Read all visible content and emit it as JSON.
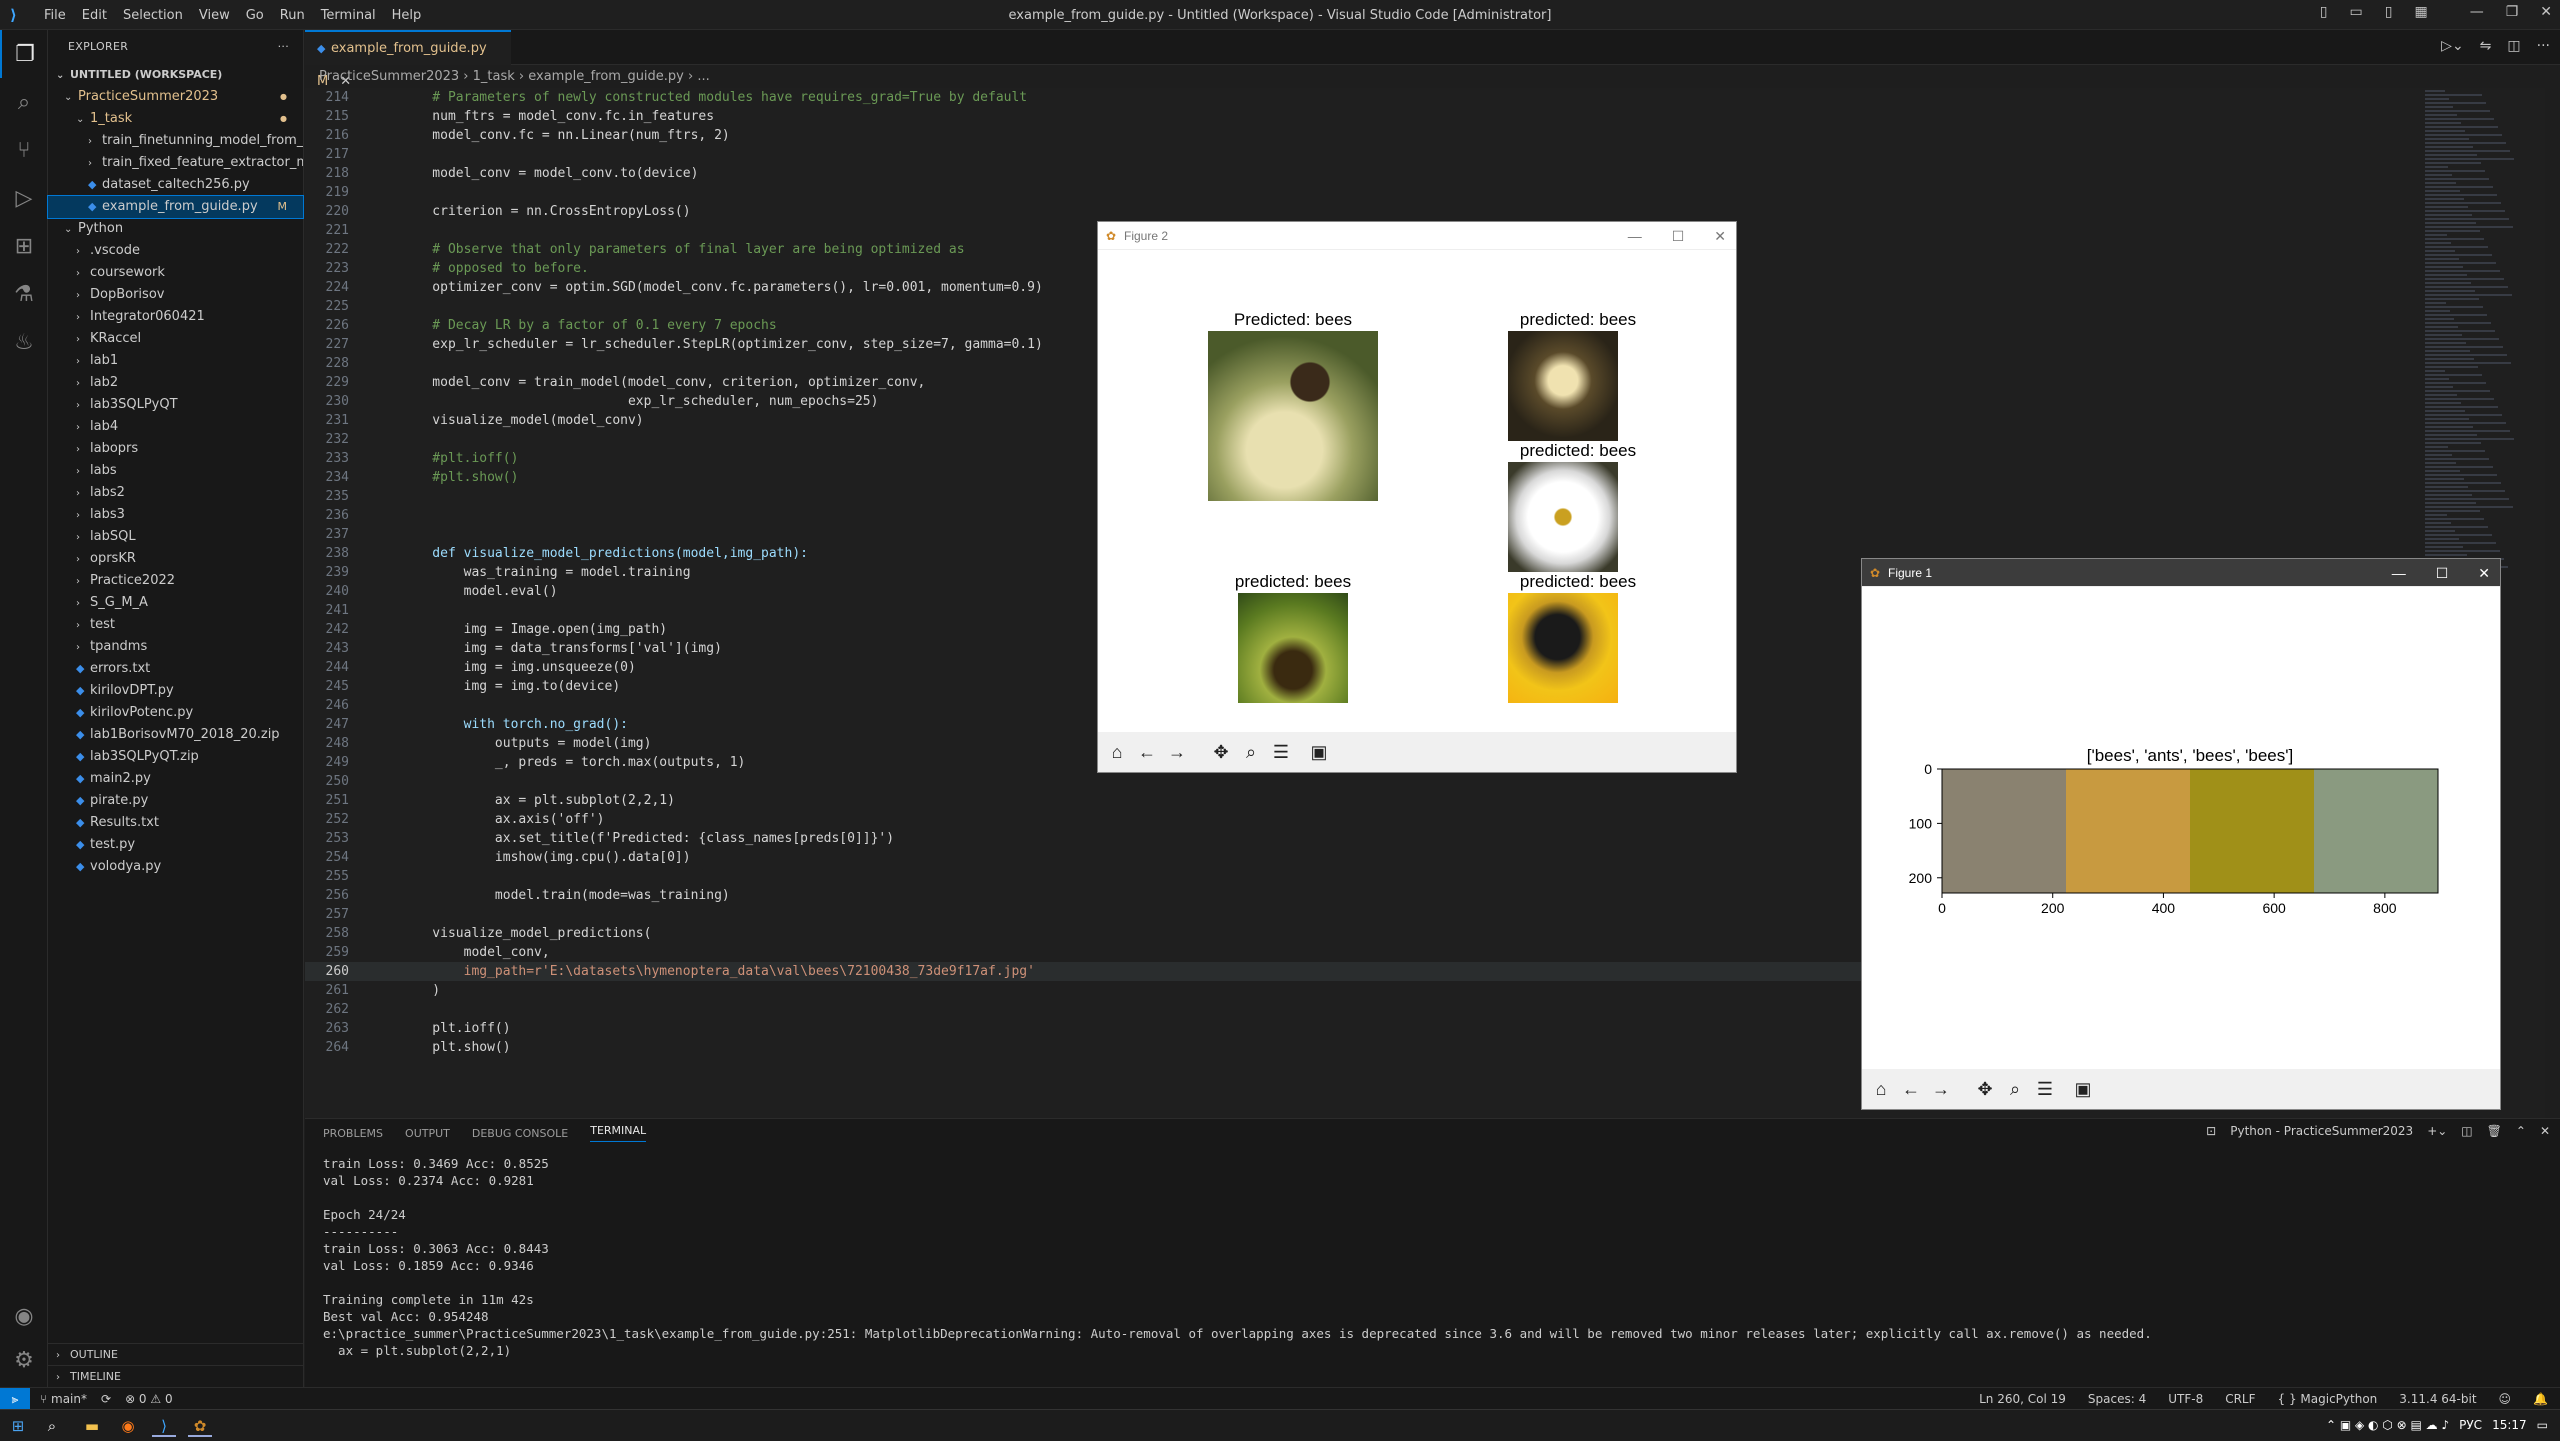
{
  "titlebar": {
    "menu": [
      "File",
      "Edit",
      "Selection",
      "View",
      "Go",
      "Run",
      "Terminal",
      "Help"
    ],
    "window_title": "example_from_guide.py - Untitled (Workspace) - Visual Studio Code [Administrator]"
  },
  "sidebar": {
    "header": "EXPLORER",
    "workspace": "UNTITLED (WORKSPACE)",
    "items": [
      {
        "label": "PracticeSummer2023",
        "depth": 1,
        "type": "folder-open",
        "mod": true
      },
      {
        "label": "1_task",
        "depth": 2,
        "type": "folder-open",
        "mod": true
      },
      {
        "label": "train_finetunning_model_from_ex...",
        "depth": 3,
        "type": "folder"
      },
      {
        "label": "train_fixed_feature_extractor_mod...",
        "depth": 3,
        "type": "folder"
      },
      {
        "label": "dataset_caltech256.py",
        "depth": 3,
        "type": "file"
      },
      {
        "label": "example_from_guide.py",
        "depth": 3,
        "type": "file",
        "status": "M",
        "selected": true
      },
      {
        "label": "Python",
        "depth": 1,
        "type": "folder-open"
      },
      {
        "label": ".vscode",
        "depth": 2,
        "type": "folder"
      },
      {
        "label": "coursework",
        "depth": 2,
        "type": "folder"
      },
      {
        "label": "DopBorisov",
        "depth": 2,
        "type": "folder"
      },
      {
        "label": "Integrator060421",
        "depth": 2,
        "type": "folder"
      },
      {
        "label": "KRaccel",
        "depth": 2,
        "type": "folder"
      },
      {
        "label": "lab1",
        "depth": 2,
        "type": "folder"
      },
      {
        "label": "lab2",
        "depth": 2,
        "type": "folder"
      },
      {
        "label": "lab3SQLPyQT",
        "depth": 2,
        "type": "folder"
      },
      {
        "label": "lab4",
        "depth": 2,
        "type": "folder"
      },
      {
        "label": "laboprs",
        "depth": 2,
        "type": "folder"
      },
      {
        "label": "labs",
        "depth": 2,
        "type": "folder"
      },
      {
        "label": "labs2",
        "depth": 2,
        "type": "folder"
      },
      {
        "label": "labs3",
        "depth": 2,
        "type": "folder"
      },
      {
        "label": "labSQL",
        "depth": 2,
        "type": "folder"
      },
      {
        "label": "oprsKR",
        "depth": 2,
        "type": "folder"
      },
      {
        "label": "Practice2022",
        "depth": 2,
        "type": "folder"
      },
      {
        "label": "S_G_M_A",
        "depth": 2,
        "type": "folder"
      },
      {
        "label": "test",
        "depth": 2,
        "type": "folder"
      },
      {
        "label": "tpandms",
        "depth": 2,
        "type": "folder"
      },
      {
        "label": "errors.txt",
        "depth": 2,
        "type": "file"
      },
      {
        "label": "kirilovDPT.py",
        "depth": 2,
        "type": "file"
      },
      {
        "label": "kirilovPotenc.py",
        "depth": 2,
        "type": "file"
      },
      {
        "label": "lab1BorisovM70_2018_20.zip",
        "depth": 2,
        "type": "file"
      },
      {
        "label": "lab3SQLPyQT.zip",
        "depth": 2,
        "type": "file"
      },
      {
        "label": "main2.py",
        "depth": 2,
        "type": "file"
      },
      {
        "label": "pirate.py",
        "depth": 2,
        "type": "file"
      },
      {
        "label": "Results.txt",
        "depth": 2,
        "type": "file"
      },
      {
        "label": "test.py",
        "depth": 2,
        "type": "file"
      },
      {
        "label": "volodya.py",
        "depth": 2,
        "type": "file"
      }
    ],
    "outline": "OUTLINE",
    "timeline": "TIMELINE"
  },
  "tab": {
    "label": "example_from_guide.py M"
  },
  "breadcrumb": "PracticeSummer2023 › 1_task › example_from_guide.py › ...",
  "code": [
    {
      "n": "214",
      "t": "    # Parameters of newly constructed modules have requires_grad=True by default"
    },
    {
      "n": "215",
      "t": "    num_ftrs = model_conv.fc.in_features"
    },
    {
      "n": "216",
      "t": "    model_conv.fc = nn.Linear(num_ftrs, 2)"
    },
    {
      "n": "217",
      "t": ""
    },
    {
      "n": "218",
      "t": "    model_conv = model_conv.to(device)"
    },
    {
      "n": "219",
      "t": ""
    },
    {
      "n": "220",
      "t": "    criterion = nn.CrossEntropyLoss()"
    },
    {
      "n": "221",
      "t": ""
    },
    {
      "n": "222",
      "t": "    # Observe that only parameters of final layer are being optimized as"
    },
    {
      "n": "223",
      "t": "    # opposed to before."
    },
    {
      "n": "224",
      "t": "    optimizer_conv = optim.SGD(model_conv.fc.parameters(), lr=0.001, momentum=0.9)"
    },
    {
      "n": "225",
      "t": ""
    },
    {
      "n": "226",
      "t": "    # Decay LR by a factor of 0.1 every 7 epochs"
    },
    {
      "n": "227",
      "t": "    exp_lr_scheduler = lr_scheduler.StepLR(optimizer_conv, step_size=7, gamma=0.1)"
    },
    {
      "n": "228",
      "t": ""
    },
    {
      "n": "229",
      "t": "    model_conv = train_model(model_conv, criterion, optimizer_conv,"
    },
    {
      "n": "230",
      "t": "                             exp_lr_scheduler, num_epochs=25)"
    },
    {
      "n": "231",
      "t": "    visualize_model(model_conv)"
    },
    {
      "n": "232",
      "t": ""
    },
    {
      "n": "233",
      "t": "    #plt.ioff()"
    },
    {
      "n": "234",
      "t": "    #plt.show()"
    },
    {
      "n": "235",
      "t": ""
    },
    {
      "n": "236",
      "t": ""
    },
    {
      "n": "237",
      "t": ""
    },
    {
      "n": "238",
      "t": "    def visualize_model_predictions(model,img_path):"
    },
    {
      "n": "239",
      "t": "        was_training = model.training"
    },
    {
      "n": "240",
      "t": "        model.eval()"
    },
    {
      "n": "241",
      "t": ""
    },
    {
      "n": "242",
      "t": "        img = Image.open(img_path)"
    },
    {
      "n": "243",
      "t": "        img = data_transforms['val'](img)"
    },
    {
      "n": "244",
      "t": "        img = img.unsqueeze(0)"
    },
    {
      "n": "245",
      "t": "        img = img.to(device)"
    },
    {
      "n": "246",
      "t": ""
    },
    {
      "n": "247",
      "t": "        with torch.no_grad():"
    },
    {
      "n": "248",
      "t": "            outputs = model(img)"
    },
    {
      "n": "249",
      "t": "            _, preds = torch.max(outputs, 1)"
    },
    {
      "n": "250",
      "t": ""
    },
    {
      "n": "251",
      "t": "            ax = plt.subplot(2,2,1)"
    },
    {
      "n": "252",
      "t": "            ax.axis('off')"
    },
    {
      "n": "253",
      "t": "            ax.set_title(f'Predicted: {class_names[preds[0]]}')"
    },
    {
      "n": "254",
      "t": "            imshow(img.cpu().data[0])"
    },
    {
      "n": "255",
      "t": ""
    },
    {
      "n": "256",
      "t": "            model.train(mode=was_training)"
    },
    {
      "n": "257",
      "t": ""
    },
    {
      "n": "258",
      "t": "    visualize_model_predictions("
    },
    {
      "n": "259",
      "t": "        model_conv,"
    },
    {
      "n": "260",
      "t": "        img_path=r'E:\\datasets\\hymenoptera_data\\val\\bees\\72100438_73de9f17af.jpg'",
      "current": true
    },
    {
      "n": "261",
      "t": "    )"
    },
    {
      "n": "262",
      "t": ""
    },
    {
      "n": "263",
      "t": "    plt.ioff()"
    },
    {
      "n": "264",
      "t": "    plt.show()"
    }
  ],
  "figure2": {
    "title": "Figure 2",
    "titles": [
      "Predicted: bees",
      "predicted: bees",
      "predicted: bees",
      "predicted: bees",
      "predicted: bees"
    ]
  },
  "figure1": {
    "title": "Figure 1",
    "plot_title": "['bees', 'ants', 'bees', 'bees']",
    "chart_data": {
      "type": "image",
      "title": "['bees', 'ants', 'bees', 'bees']",
      "x_ticks": [
        "0",
        "200",
        "400",
        "600",
        "800"
      ],
      "y_ticks": [
        "0",
        "100",
        "200"
      ]
    }
  },
  "panel": {
    "tabs": [
      "PROBLEMS",
      "OUTPUT",
      "DEBUG CONSOLE",
      "TERMINAL"
    ],
    "terminal_name": "Python - PracticeSummer2023",
    "lines": [
      "train Loss: 0.3469 Acc: 0.8525",
      "val Loss: 0.2374 Acc: 0.9281",
      "",
      "Epoch 24/24",
      "----------",
      "train Loss: 0.3063 Acc: 0.8443",
      "val Loss: 0.1859 Acc: 0.9346",
      "",
      "Training complete in 11m 42s",
      "Best val Acc: 0.954248",
      "e:\\practice_summer\\PracticeSummer2023\\1_task\\example_from_guide.py:251: MatplotlibDeprecationWarning: Auto-removal of overlapping axes is deprecated since 3.6 and will be removed two minor releases later; explicitly call ax.remove() as needed.",
      "  ax = plt.subplot(2,2,1)"
    ]
  },
  "status": {
    "branch": "main*",
    "problems": "⊗ 0 ⚠ 0",
    "position": "Ln 260, Col 19",
    "spaces": "Spaces: 4",
    "encoding": "UTF-8",
    "eol": "CRLF",
    "language": "MagicPython",
    "interpreter": "3.11.4 64-bit"
  },
  "taskbar": {
    "lang": "РУС",
    "time": "15:17"
  }
}
